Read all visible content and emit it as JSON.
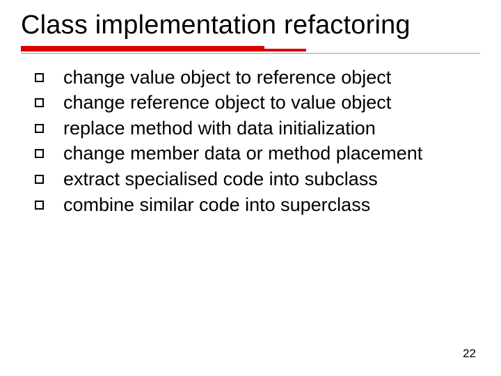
{
  "title": "Class implementation refactoring",
  "bullets": [
    "change value object to reference object",
    "change reference object to value object",
    "replace method with data initialization",
    "change member data or method placement",
    "extract specialised code into subclass",
    "combine similar code into superclass"
  ],
  "page_number": "22"
}
